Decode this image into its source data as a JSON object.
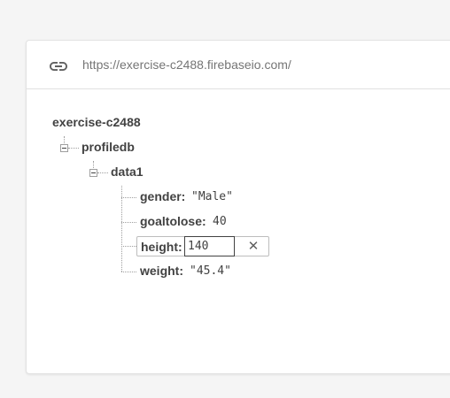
{
  "url_bar": {
    "icon": "link-icon",
    "url": "https://exercise-c2488.firebaseio.com/"
  },
  "tree": {
    "root": "exercise-c2488",
    "profiledb": "profiledb",
    "data1": "data1",
    "fields": {
      "gender": {
        "key": "gender:",
        "value": "\"Male\""
      },
      "goaltolose": {
        "key": "goaltolose:",
        "value": "40"
      },
      "height": {
        "key": "height:",
        "value": "140"
      },
      "weight": {
        "key": "weight:",
        "value": "\"45.4\""
      }
    }
  },
  "edit": {
    "close_icon": "close-icon",
    "close_glyph": "✕"
  }
}
